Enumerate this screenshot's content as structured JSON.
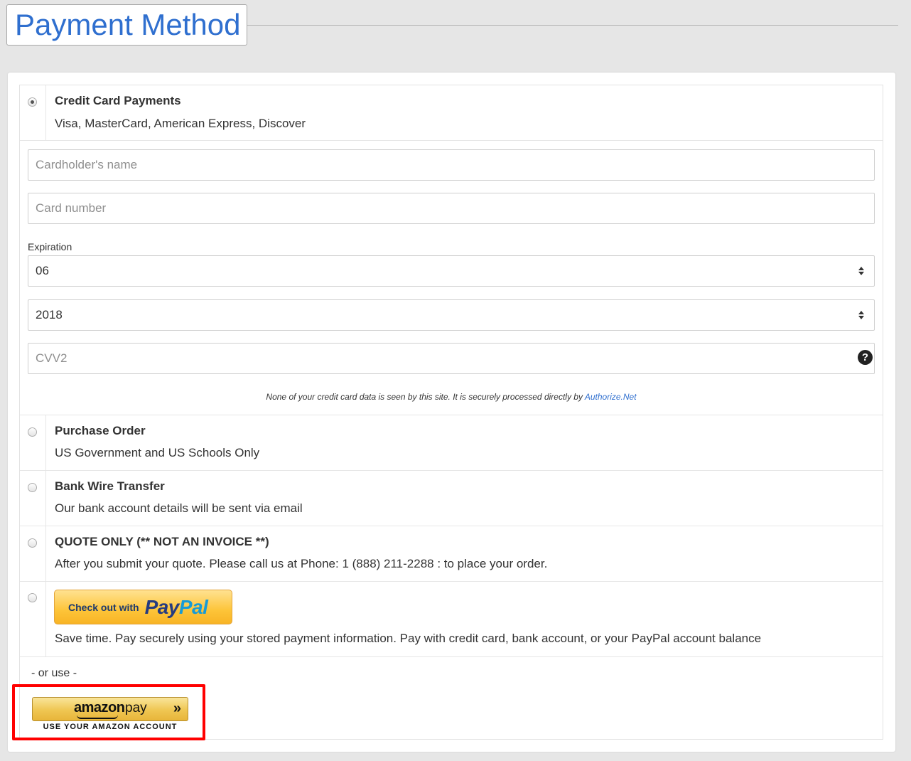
{
  "page": {
    "title": "Payment Method"
  },
  "credit_card": {
    "title": "Credit Card Payments",
    "description": "Visa, MasterCard, American Express, Discover",
    "selected": true,
    "cardholder_placeholder": "Cardholder's name",
    "card_number_placeholder": "Card number",
    "expiration_label": "Expiration",
    "expiration_month": "06",
    "expiration_year": "2018",
    "cvv_placeholder": "CVV2",
    "help_icon": "question-circle-icon",
    "secure_note": "None of your credit card data is seen by this site. It is securely processed directly by ",
    "secure_link": "Authorize.Net"
  },
  "purchase_order": {
    "title": "Purchase Order",
    "description": "US Government and US Schools Only"
  },
  "bank_wire": {
    "title": "Bank Wire Transfer",
    "description": "Our bank account details will be sent via email"
  },
  "quote_only": {
    "title": "QUOTE ONLY (** NOT AN INVOICE **)",
    "description": "After you submit your quote. Please call us at Phone: 1 (888) 211-2288 : to place your order."
  },
  "paypal": {
    "button_prefix": "Check out with",
    "logo_pay": "Pay",
    "logo_pal": "Pal",
    "description": "Save time. Pay securely using your stored payment information. Pay with credit card, bank account, or your PayPal account balance"
  },
  "amazon": {
    "or_use": "- or use -",
    "logo_word": "amazon",
    "pay_word": "pay",
    "chevron": "»",
    "caption": "USE YOUR AMAZON ACCOUNT"
  },
  "colors": {
    "heading": "#2f6fcf",
    "highlight": "#ff0000",
    "paypal_button": "#fdc439"
  }
}
